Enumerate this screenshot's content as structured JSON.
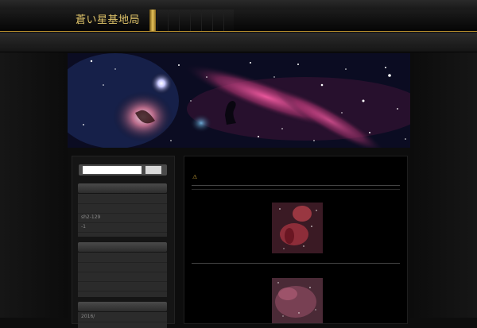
{
  "header": {
    "site_title": "蒼い星基地局"
  },
  "sidebar": {
    "search": {
      "value": "",
      "button_label": ""
    },
    "widgets": [
      {
        "items": [
          "",
          "",
          "sh2-129",
          "-1",
          ""
        ]
      },
      {
        "items": [
          "",
          "",
          "",
          "",
          ""
        ]
      },
      {
        "items": [
          "2016/",
          ""
        ]
      }
    ]
  },
  "main": {
    "post_icon": "⚠"
  },
  "colors": {
    "accent_gold": "#b8902f",
    "title_gold": "#e0c46a"
  }
}
